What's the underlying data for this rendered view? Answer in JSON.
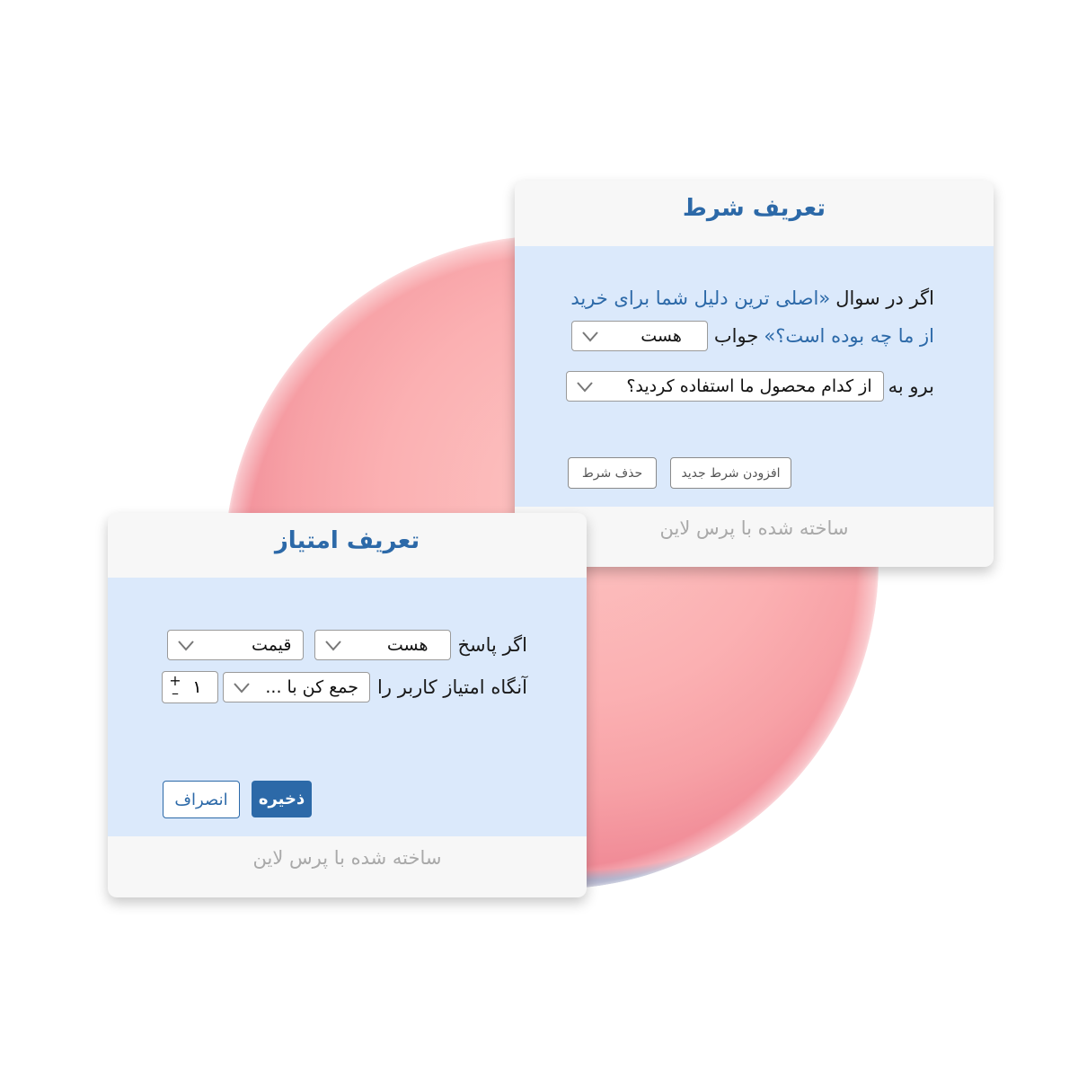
{
  "condition_card": {
    "title": "تعریف شرط",
    "line1_prefix": "اگر در سوال",
    "line1_question": "«اصلی ترین دلیل شما برای خرید",
    "line2_question": "از ما چه بوده است؟»",
    "line2_suffix": "جواب",
    "answer_select": "هست",
    "goto_label": "برو به",
    "goto_select": "از کدام محصول ما استفاده کردید؟",
    "add_button": "افزودن شرط جدید",
    "delete_button": "حذف شرط",
    "footer": "ساخته شده با پرس لاین"
  },
  "score_card": {
    "title": "تعریف امتیاز",
    "if_answer_label": "اگر پاسخ",
    "operator_select": "هست",
    "field_select": "قیمت",
    "then_label": "آنگاه امتیاز کاربر را",
    "action_select": "جمع کن با ...",
    "stepper_value": "۱",
    "stepper_plus": "+",
    "stepper_minus": "–",
    "save_button": "ذخیره",
    "cancel_button": "انصراف",
    "footer": "ساخته شده با پرس لاین"
  },
  "colors": {
    "accent": "#2c69a8",
    "panel_body": "#dbe9fb",
    "card_bg": "#f7f7f7",
    "footer_text": "#a9a9a9"
  }
}
